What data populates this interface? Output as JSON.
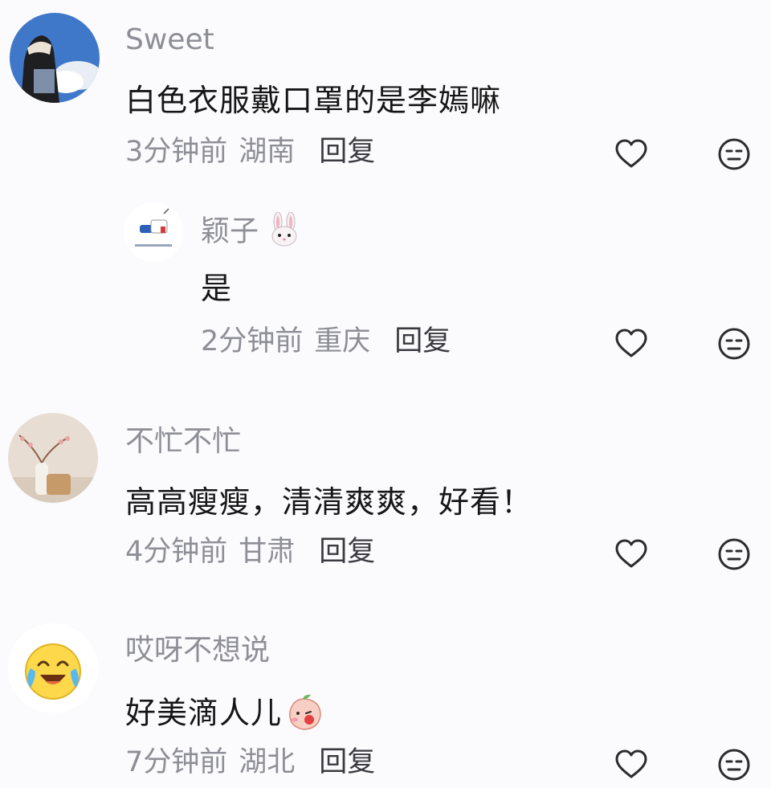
{
  "comments": [
    {
      "name": "Sweet",
      "text": "白色衣服戴口罩的是李嫣嘛",
      "time": "3分钟前",
      "region": "湖南",
      "reply": "回复"
    },
    {
      "name": "颖子",
      "name_emoji": "rabbit-face",
      "text": "是",
      "time": "2分钟前",
      "region": "重庆",
      "reply": "回复"
    },
    {
      "name": "不忙不忙",
      "text": "高高瘦瘦，清清爽爽，好看！",
      "time": "4分钟前",
      "region": "甘肃",
      "reply": "回复"
    },
    {
      "name": "哎呀不想说",
      "text": "好美滴人儿",
      "text_emoji": "blowing-kiss-peach",
      "time": "7分钟前",
      "region": "湖北",
      "reply": "回复"
    }
  ],
  "colors": {
    "background": "#fbfbfd",
    "name": "#8e8e96",
    "text": "#161616",
    "icon": "#2b2b30"
  },
  "icons": [
    "heart-outline-icon",
    "neutral-face-icon"
  ]
}
